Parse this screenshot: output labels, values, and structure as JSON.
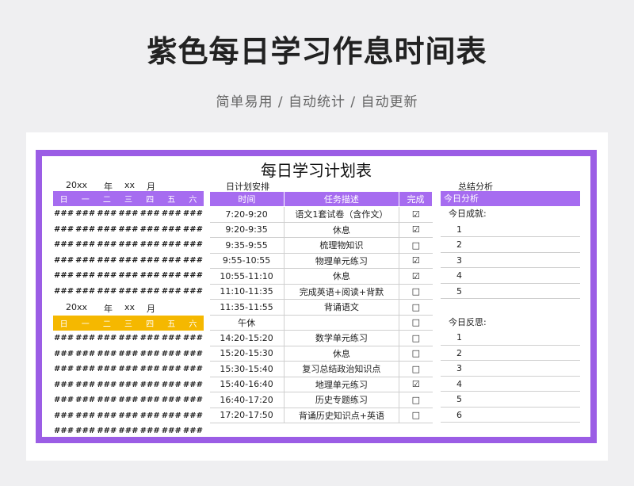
{
  "hero": {
    "title": "紫色每日学习作息时间表",
    "subtitle": "简单易用 / 自动统计 / 自动更新"
  },
  "sheet": {
    "title": "每日学习计划表",
    "plan_label": "日计划安排",
    "summary_label": "总结分析"
  },
  "calendar1": {
    "year": "20xx",
    "year_unit": "年",
    "month": "xx",
    "month_unit": "月",
    "weekdays": [
      "日",
      "一",
      "二",
      "三",
      "四",
      "五",
      "六"
    ],
    "cell": "###"
  },
  "calendar2": {
    "year": "20xx",
    "year_unit": "年",
    "month": "xx",
    "month_unit": "月",
    "weekdays": [
      "日",
      "一",
      "二",
      "三",
      "四",
      "五",
      "六"
    ],
    "cell": "###"
  },
  "plan": {
    "headers": [
      "时间",
      "任务描述",
      "完成"
    ],
    "rows": [
      {
        "time": "7:20-9:20",
        "task": "语文1套试卷（含作文）",
        "done": "☑"
      },
      {
        "time": "9:20-9:35",
        "task": "休息",
        "done": "☑"
      },
      {
        "time": "9:35-9:55",
        "task": "梳理物知识",
        "done": "□"
      },
      {
        "time": "9:55-10:55",
        "task": "物理单元练习",
        "done": "☑"
      },
      {
        "time": "10:55-11:10",
        "task": "休息",
        "done": "☑"
      },
      {
        "time": "11:10-11:35",
        "task": "完成英语+阅读+背默",
        "done": "□"
      },
      {
        "time": "11:35-11:55",
        "task": "背诵语文",
        "done": "□"
      },
      {
        "time": "午休",
        "task": "",
        "done": "□"
      },
      {
        "time": "14:20-15:20",
        "task": "数学单元练习",
        "done": "□"
      },
      {
        "time": "15:20-15:30",
        "task": "休息",
        "done": "□"
      },
      {
        "time": "15:30-15:40",
        "task": "复习总结政治知识点",
        "done": "□"
      },
      {
        "time": "15:40-16:40",
        "task": "地理单元练习",
        "done": "☑"
      },
      {
        "time": "16:40-17:20",
        "task": "历史专题练习",
        "done": "□"
      },
      {
        "time": "17:20-17:50",
        "task": "背诵历史知识点+英语",
        "done": "□"
      }
    ]
  },
  "summary": {
    "header": "今日分析",
    "achievements_label": "今日成就:",
    "achievements": [
      "1",
      "2",
      "3",
      "4",
      "5"
    ],
    "reflection_label": "今日反思:",
    "reflections": [
      "1",
      "2",
      "3",
      "4",
      "5",
      "6"
    ]
  }
}
